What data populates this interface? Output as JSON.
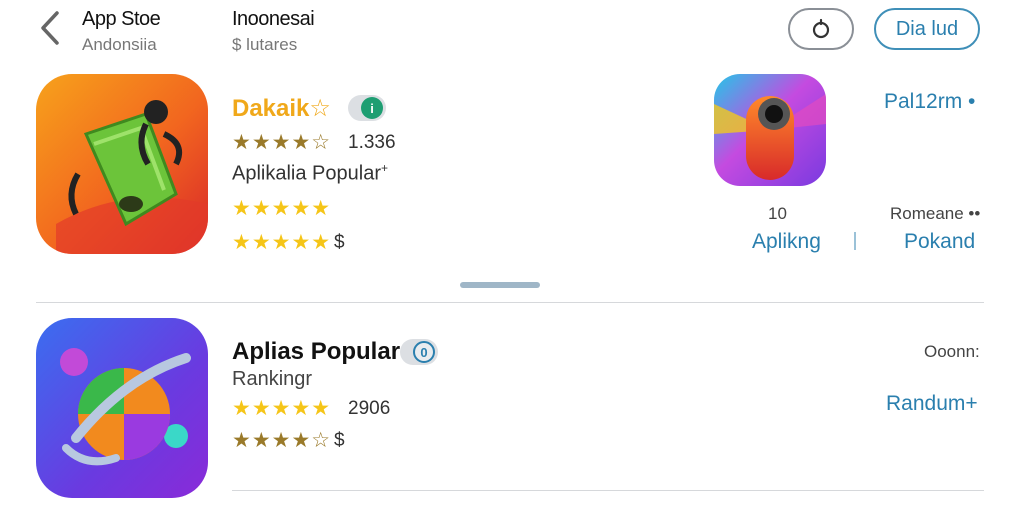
{
  "header": {
    "title": "App Stoe",
    "subtitle": "Andonsiia",
    "region": "Inoonesai",
    "region_sub": "$ lutares",
    "pill_right_label": "Dia lud"
  },
  "apps": [
    {
      "name": "Dakaik☆",
      "badge": "i",
      "rating_count": "1.336",
      "category": "Aplikalia Popular",
      "category_mark": "+",
      "price": "$"
    },
    {
      "name": "Aplias Popular",
      "badge": "0",
      "subtitle": "Rankingr",
      "rating_count": "2906",
      "price": "$"
    }
  ],
  "featured": {
    "top_link": "Pal12rm •",
    "count": "10",
    "label_right": "Romeane ••",
    "link_left": "Aplikng",
    "link_right": "Pokand"
  },
  "second_right": {
    "label": "Ooonn:",
    "link": "Randum+"
  },
  "icons": {
    "back": "chevron-left-icon",
    "pill_left": "refresh-icon"
  },
  "colors": {
    "accent": "#2a7fae",
    "star": "#f5c518",
    "badge": "#1e9e72"
  }
}
